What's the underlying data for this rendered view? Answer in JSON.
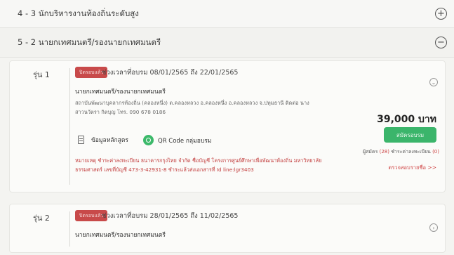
{
  "sections": [
    {
      "title": "4 - 3 นักบริหารงานท้องถิ่นระดับสูง",
      "toggle": "+"
    },
    {
      "title": "5 - 2 นายกเทศมนตรี/รองนายกเทศมนตรี",
      "toggle": "−"
    }
  ],
  "rounds": [
    {
      "label": "รุ่น 1",
      "badge": "ปิดรอบแล้ว",
      "period": "ช่วงเวลาที่อบรม 08/01/2565 ถึง 22/01/2565",
      "course": "นายกเทศมนตรี/รองนายกเทศมนตรี",
      "venue": "สถาบันพัฒนาบุคลากรท้องถิ่น (คลองหนึ่ง) ต.คลองหลวง อ.คลองหนึ่ง อ.คลองหลวง จ.ปทุมธานี ติดต่อ นางสาวนวัตรา กิตบุญ โทร. 090 678 0186",
      "curriculum": "ข้อมูลหลักสูตร",
      "qr": "QR Code กลุ่มอบรม",
      "note": "หมายเหตุ ชำระค่าลงทะเบียน ธนาคารกรุงไทย จำกัด ชื่อบัญชี โครงการศูนย์ศึกษาเพื่อพัฒนาท้องถิ่น มหาวิทยาลัยธรรมศาสตร์ เลขที่บัญชี 473-3-42931-8 ชำระแล้วส่งเอกสารที่ Id line:lgr3403",
      "price": "39,000 บาท",
      "register": "สมัครอบรม",
      "applicants_prefix": "ผู้สมัคร",
      "applicants_count": "(28)",
      "paid_prefix": "ชำระค่าลงทะเบียน",
      "paid_count": "(0)",
      "check_list": "ตรวจสอบรายชื่อ >>",
      "chevron": "⌄"
    },
    {
      "label": "รุ่น 2",
      "badge": "ปิดรอบแล้ว",
      "period": "ช่วงเวลาที่อบรม 28/01/2565 ถึง 11/02/2565",
      "course": "นายกเทศมนตรี/รองนายกเทศมนตรี",
      "chevron": "›"
    }
  ],
  "colors": {
    "badge": "#c84a4a",
    "register": "#3bb56b",
    "note": "#c23c3c"
  },
  "icons": {
    "curriculum": "document-icon",
    "qr": "qr-circle-icon",
    "toggle_plus": "plus-circle-icon",
    "toggle_minus": "minus-circle-icon"
  }
}
